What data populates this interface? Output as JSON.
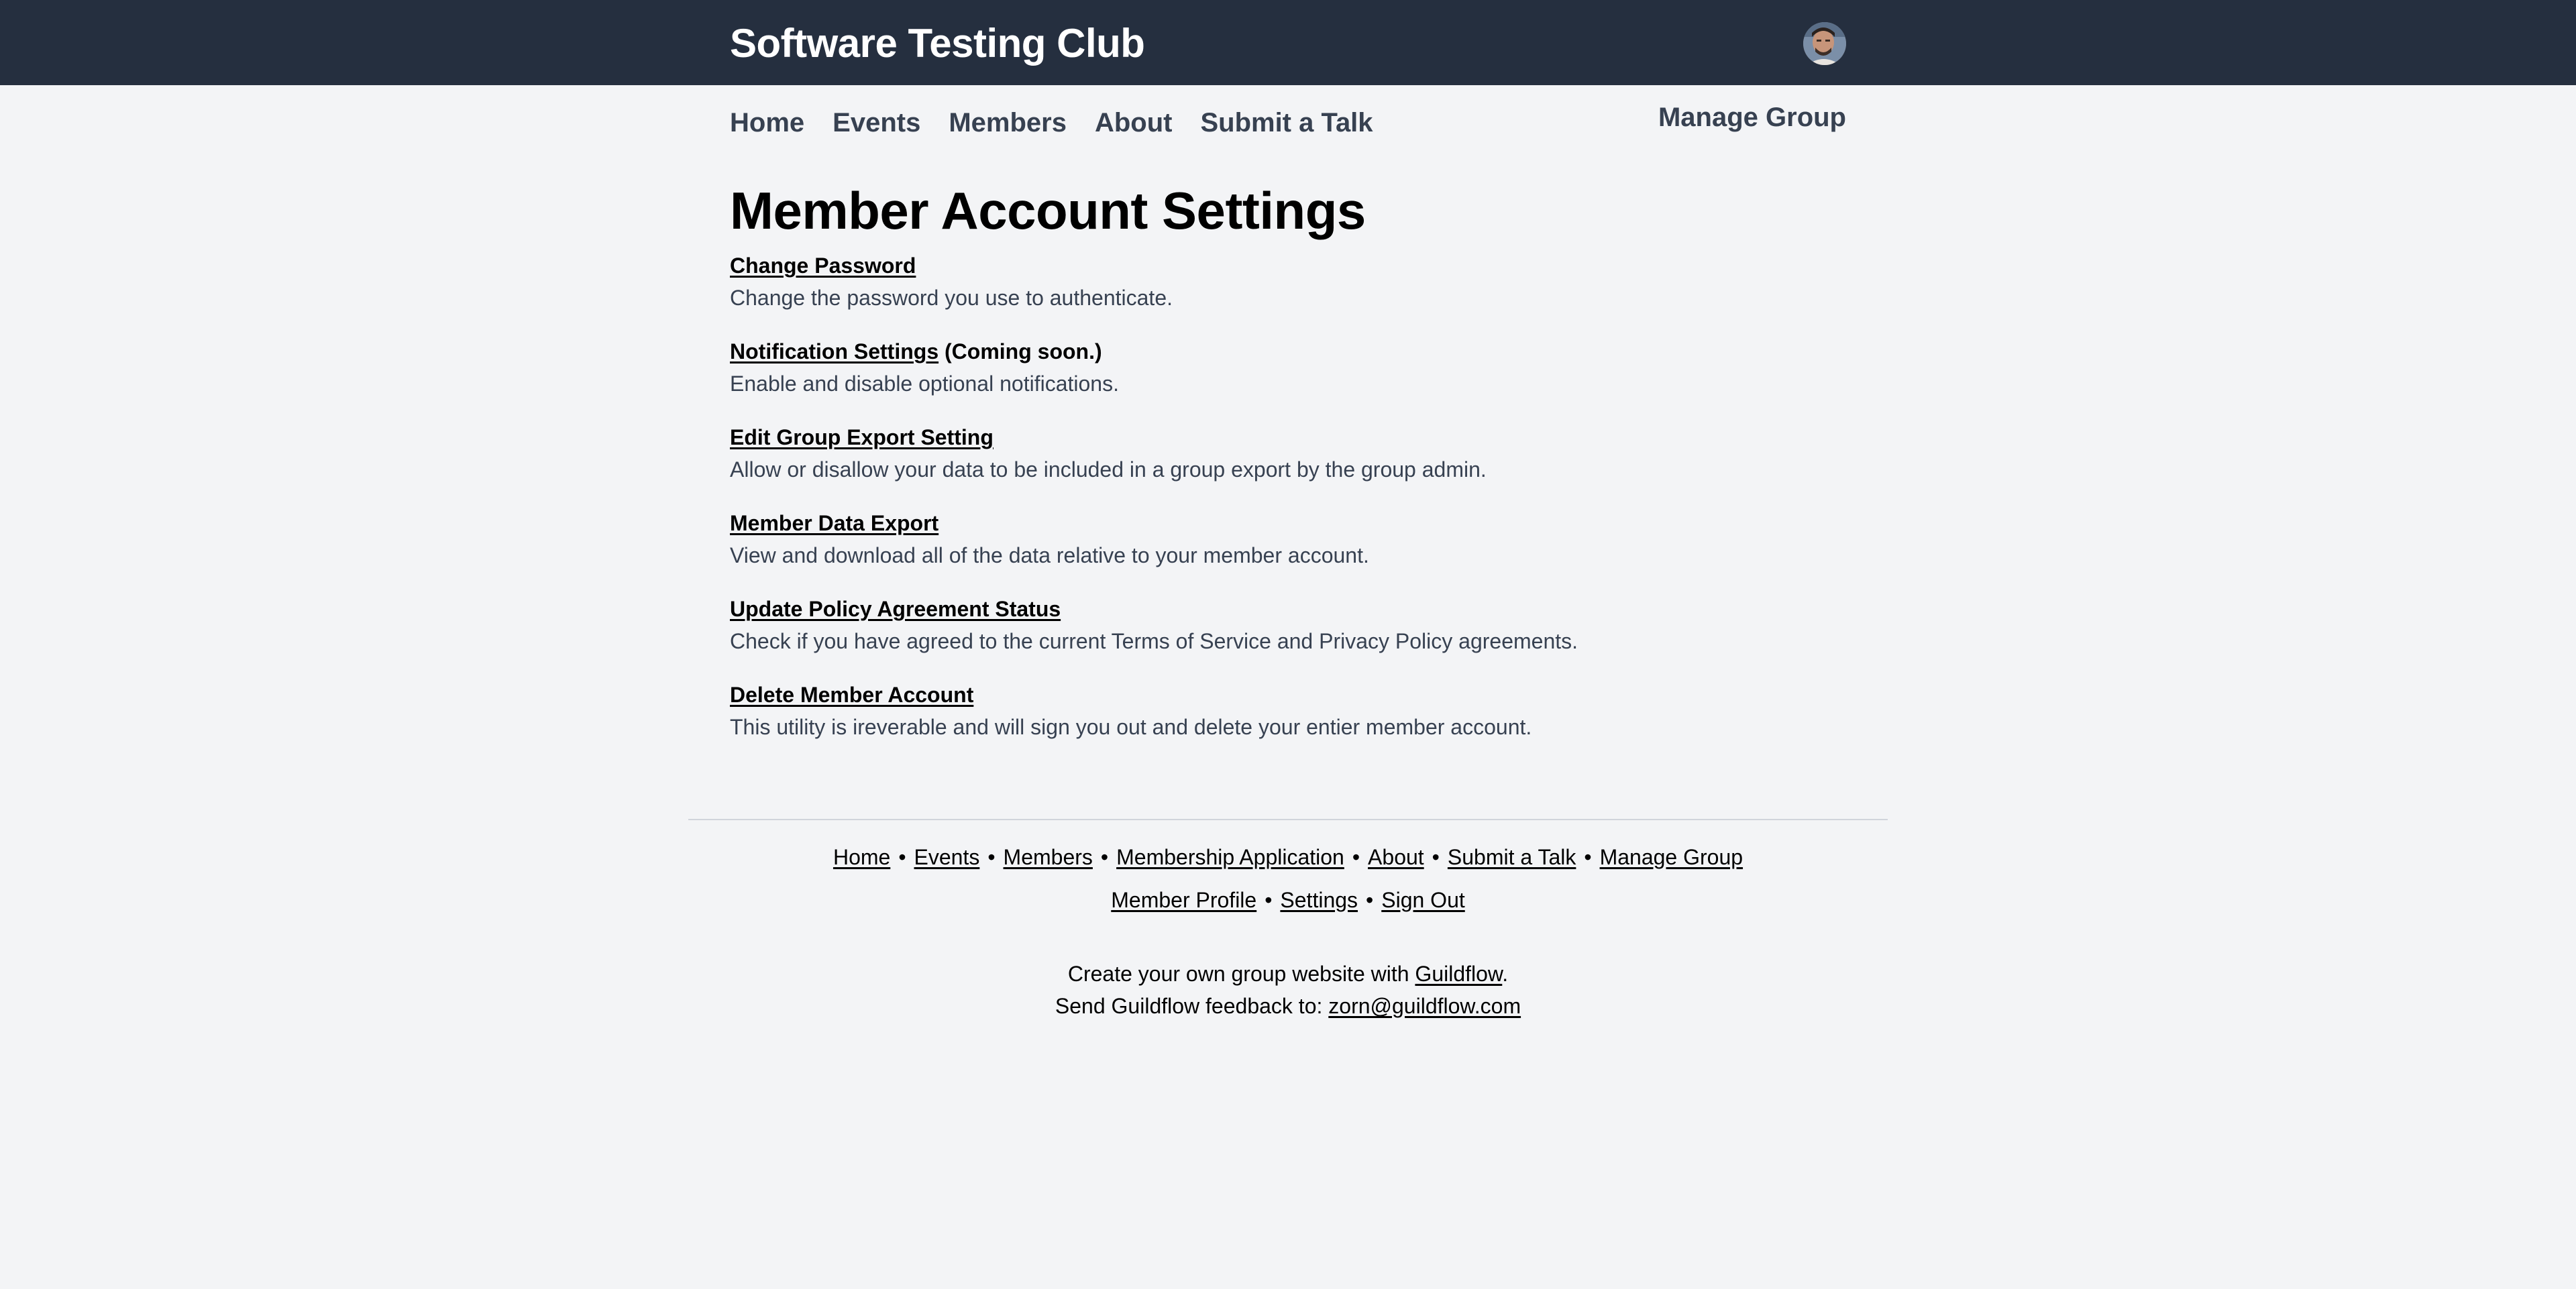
{
  "header": {
    "title": "Software Testing Club",
    "avatar_icon": "user-avatar"
  },
  "nav": {
    "items": [
      "Home",
      "Events",
      "Members",
      "About",
      "Submit a Talk"
    ],
    "manage_group": "Manage Group"
  },
  "main": {
    "title": "Member Account Settings",
    "settings": [
      {
        "label": "Change Password",
        "note": "",
        "description": "Change the password you use to authenticate."
      },
      {
        "label": "Notification Settings",
        "note": "(Coming soon.)",
        "description": "Enable and disable optional notifications."
      },
      {
        "label": "Edit Group Export Setting",
        "note": "",
        "description": "Allow or disallow your data to be included in a group export by the group admin."
      },
      {
        "label": "Member Data Export",
        "note": "",
        "description": "View and download all of the data relative to your member account."
      },
      {
        "label": "Update Policy Agreement Status",
        "note": "",
        "description": "Check if you have agreed to the current Terms of Service and Privacy Policy agreements."
      },
      {
        "label": "Delete Member Account",
        "note": "",
        "description": "This utility is ireverable and will sign you out and delete your entier member account."
      }
    ]
  },
  "footer": {
    "separator": "•",
    "row1": [
      "Home",
      "Events",
      "Members",
      "Membership Application",
      "About",
      "Submit a Talk",
      "Manage Group"
    ],
    "row2": [
      "Member Profile",
      "Settings",
      "Sign Out"
    ],
    "credit_prefix": "Create your own group website with ",
    "credit_link": "Guildflow",
    "credit_suffix": ".",
    "feedback_prefix": "Send Guildflow feedback to: ",
    "feedback_email": "zorn@guildflow.com"
  },
  "colors": {
    "header_bg": "#252f3f",
    "page_bg": "#f3f4f6",
    "nav_text": "#374151",
    "description_text": "#374151"
  }
}
